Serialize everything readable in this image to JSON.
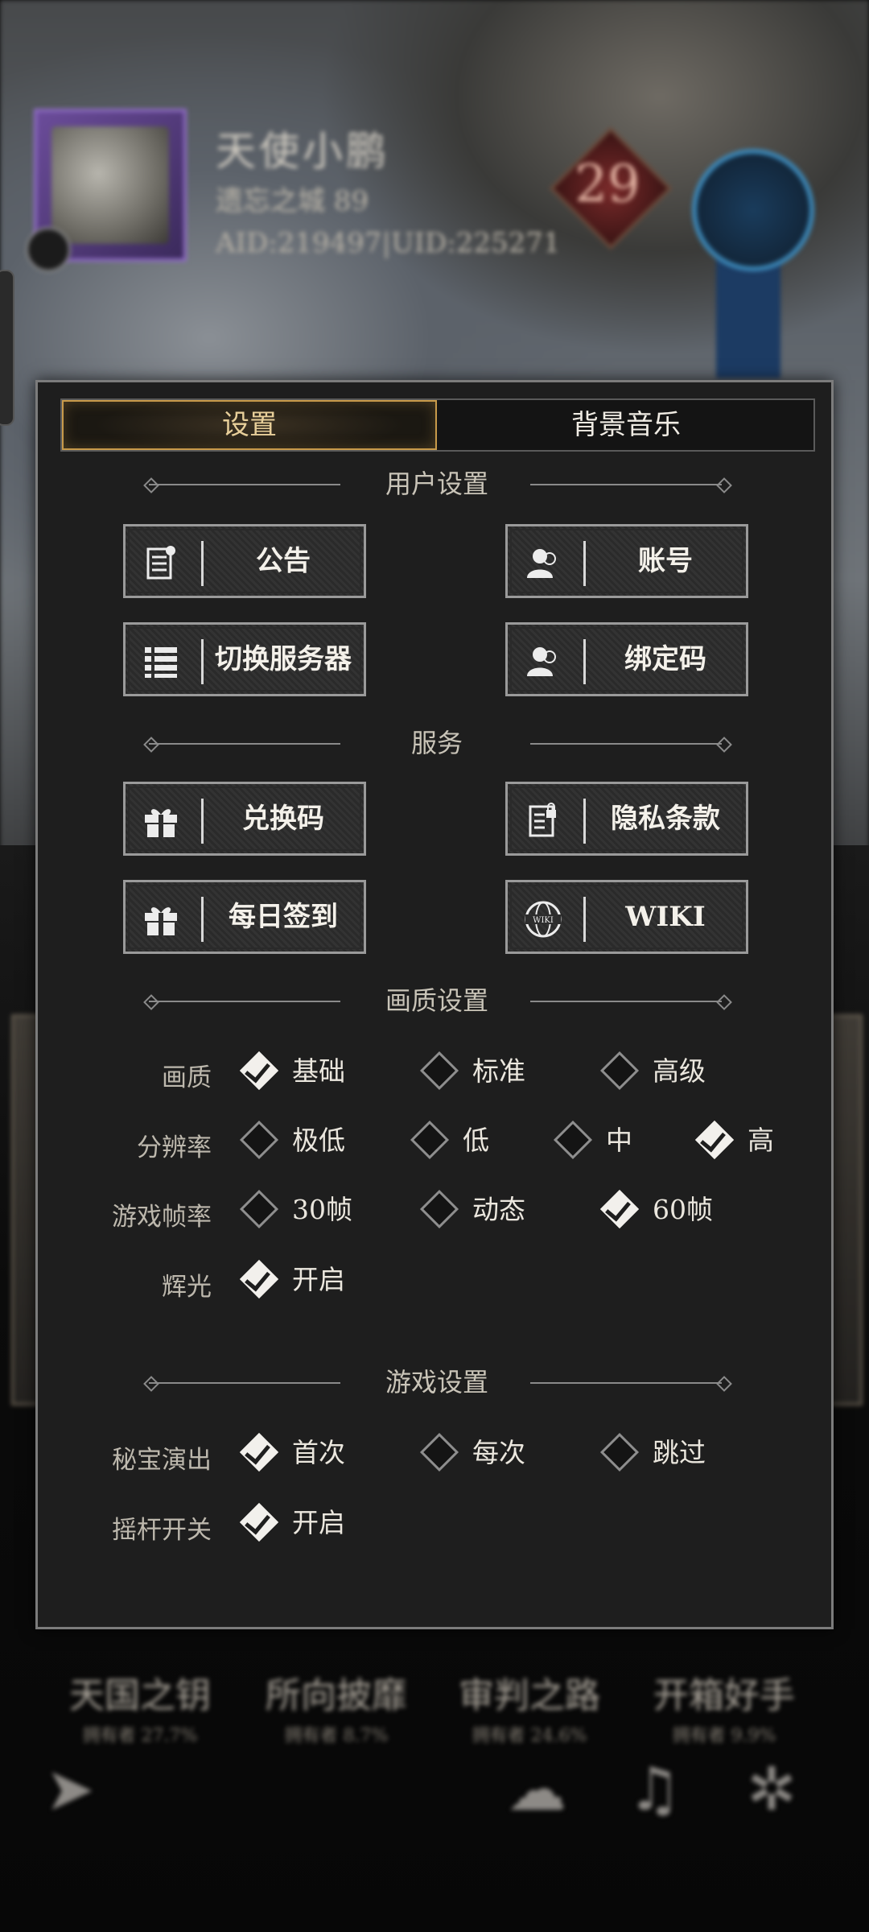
{
  "profile": {
    "name": "天使小鹏",
    "guild": "遗忘之城 89",
    "ids": "AID:219497|UID:225271",
    "level": "29"
  },
  "achievements": [
    {
      "name": "天国之钥",
      "sub": "拥有者 27.7%"
    },
    {
      "name": "所向披靡",
      "sub": "拥有者 8.7%"
    },
    {
      "name": "审判之路",
      "sub": "拥有者 24.6%"
    },
    {
      "name": "开箱好手",
      "sub": "拥有者 9.9%"
    }
  ],
  "tabs": {
    "settings": "设置",
    "bgm": "背景音乐"
  },
  "sections": {
    "user": "用户设置",
    "service": "服务",
    "quality": "画质设置",
    "game": "游戏设置"
  },
  "buttons": {
    "notice": "公告",
    "account": "账号",
    "switch_server": "切换服务器",
    "bind_code": "绑定码",
    "redeem": "兑换码",
    "privacy": "隐私条款",
    "checkin": "每日签到",
    "wiki": "WIKI"
  },
  "quality": {
    "label": "画质",
    "options": [
      "基础",
      "标准",
      "高级"
    ],
    "selected": "基础"
  },
  "resolution": {
    "label": "分辨率",
    "options": [
      "极低",
      "低",
      "中",
      "高"
    ],
    "selected": "高"
  },
  "framerate": {
    "label": "游戏帧率",
    "options": [
      "30帧",
      "动态",
      "60帧"
    ],
    "selected": "60帧"
  },
  "glow": {
    "label": "辉光",
    "options": [
      "开启"
    ],
    "selected": "开启"
  },
  "treasure": {
    "label": "秘宝演出",
    "options": [
      "首次",
      "每次",
      "跳过"
    ],
    "selected": "首次"
  },
  "joystick": {
    "label": "摇杆开关",
    "options": [
      "开启"
    ],
    "selected": "开启"
  }
}
